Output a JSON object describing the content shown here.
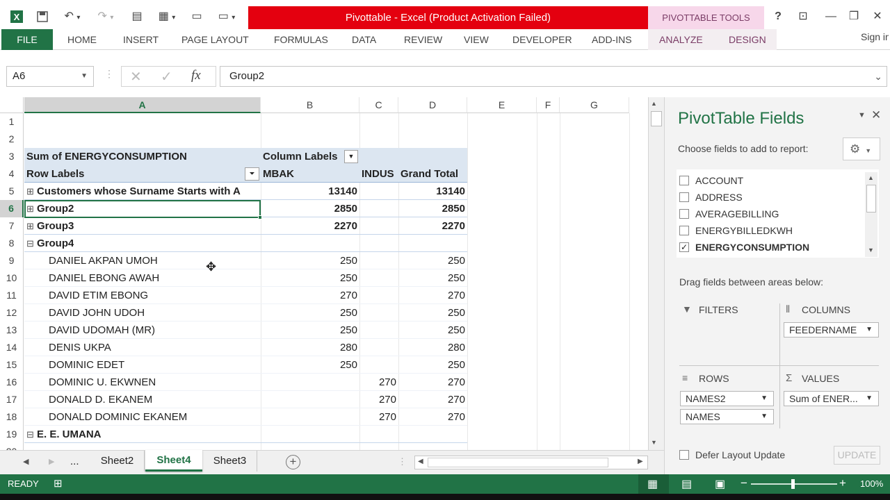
{
  "window": {
    "title": "Pivottable -  Excel (Product Activation Failed)",
    "tools_tab": "PIVOTTABLE TOOLS",
    "help": "?",
    "sign_in": "Sign in"
  },
  "ribbon": {
    "tabs": [
      "FILE",
      "HOME",
      "INSERT",
      "PAGE LAYOUT",
      "FORMULAS",
      "DATA",
      "REVIEW",
      "VIEW",
      "DEVELOPER",
      "ADD-INS",
      "ANALYZE",
      "DESIGN"
    ]
  },
  "formula_bar": {
    "name_box": "A6",
    "fx": "fx",
    "formula": "Group2"
  },
  "grid": {
    "columns": [
      "A",
      "B",
      "C",
      "D",
      "E",
      "F",
      "G"
    ],
    "rows": [
      "1",
      "2",
      "3",
      "4",
      "5",
      "6",
      "7",
      "8",
      "9",
      "10",
      "11",
      "12",
      "13",
      "14",
      "15",
      "16",
      "17",
      "18",
      "19",
      "20"
    ],
    "header_cells": {
      "r3a": "Sum of ENERGYCONSUMPTION",
      "r3b": "Column Labels",
      "r4a": "Row Labels",
      "r4b": "MBAK",
      "r4c": "INDUS",
      "r4d": "Grand Total"
    },
    "data_rows": [
      {
        "label": "Customers whose Surname Starts with A",
        "b": "13140",
        "c": "",
        "d": "13140",
        "toggle": "⊞",
        "bold": true
      },
      {
        "label": "Group2",
        "b": "2850",
        "c": "",
        "d": "2850",
        "toggle": "⊞",
        "bold": true
      },
      {
        "label": "Group3",
        "b": "2270",
        "c": "",
        "d": "2270",
        "toggle": "⊞",
        "bold": true
      },
      {
        "label": "Group4",
        "b": "",
        "c": "",
        "d": "",
        "toggle": "⊟",
        "bold": true
      },
      {
        "label": "DANIEL AKPAN UMOH",
        "b": "250",
        "c": "",
        "d": "250",
        "toggle": "",
        "bold": false
      },
      {
        "label": "DANIEL EBONG AWAH",
        "b": "250",
        "c": "",
        "d": "250",
        "toggle": "",
        "bold": false
      },
      {
        "label": "DAVID ETIM EBONG",
        "b": "270",
        "c": "",
        "d": "270",
        "toggle": "",
        "bold": false
      },
      {
        "label": "DAVID JOHN UDOH",
        "b": "250",
        "c": "",
        "d": "250",
        "toggle": "",
        "bold": false
      },
      {
        "label": "DAVID UDOMAH (MR)",
        "b": "250",
        "c": "",
        "d": "250",
        "toggle": "",
        "bold": false
      },
      {
        "label": "DENIS UKPA",
        "b": "280",
        "c": "",
        "d": "280",
        "toggle": "",
        "bold": false
      },
      {
        "label": "DOMINIC EDET",
        "b": "250",
        "c": "",
        "d": "250",
        "toggle": "",
        "bold": false
      },
      {
        "label": "DOMINIC U. EKWNEN",
        "b": "",
        "c": "270",
        "d": "270",
        "toggle": "",
        "bold": false
      },
      {
        "label": "DONALD D. EKANEM",
        "b": "",
        "c": "270",
        "d": "270",
        "toggle": "",
        "bold": false
      },
      {
        "label": "DONALD DOMINIC EKANEM",
        "b": "",
        "c": "270",
        "d": "270",
        "toggle": "",
        "bold": false
      },
      {
        "label": "E. E. UMANA",
        "b": "",
        "c": "",
        "d": "",
        "toggle": "⊟",
        "bold": true
      }
    ]
  },
  "sheets": {
    "ellipsis": "...",
    "tabs": [
      "Sheet2",
      "Sheet4",
      "Sheet3"
    ],
    "active": "Sheet4",
    "add": "+"
  },
  "panel": {
    "title": "PivotTable Fields",
    "subtitle": "Choose fields to add to report:",
    "fields": [
      {
        "name": "ACCOUNT",
        "checked": false
      },
      {
        "name": "ADDRESS",
        "checked": false
      },
      {
        "name": "AVERAGEBILLING",
        "checked": false
      },
      {
        "name": "ENERGYBILLEDKWH",
        "checked": false
      },
      {
        "name": "ENERGYCONSUMPTION",
        "checked": true
      }
    ],
    "drag_label": "Drag fields between areas below:",
    "filters_label": "FILTERS",
    "columns_label": "COLUMNS",
    "rows_label": "ROWS",
    "values_label": "VALUES",
    "columns_items": [
      "FEEDERNAME"
    ],
    "rows_items": [
      "NAMES2",
      "NAMES"
    ],
    "values_items": [
      "Sum of ENER..."
    ],
    "defer_label": "Defer Layout Update",
    "update_label": "UPDATE"
  },
  "status": {
    "ready": "READY",
    "zoom": "100%"
  }
}
